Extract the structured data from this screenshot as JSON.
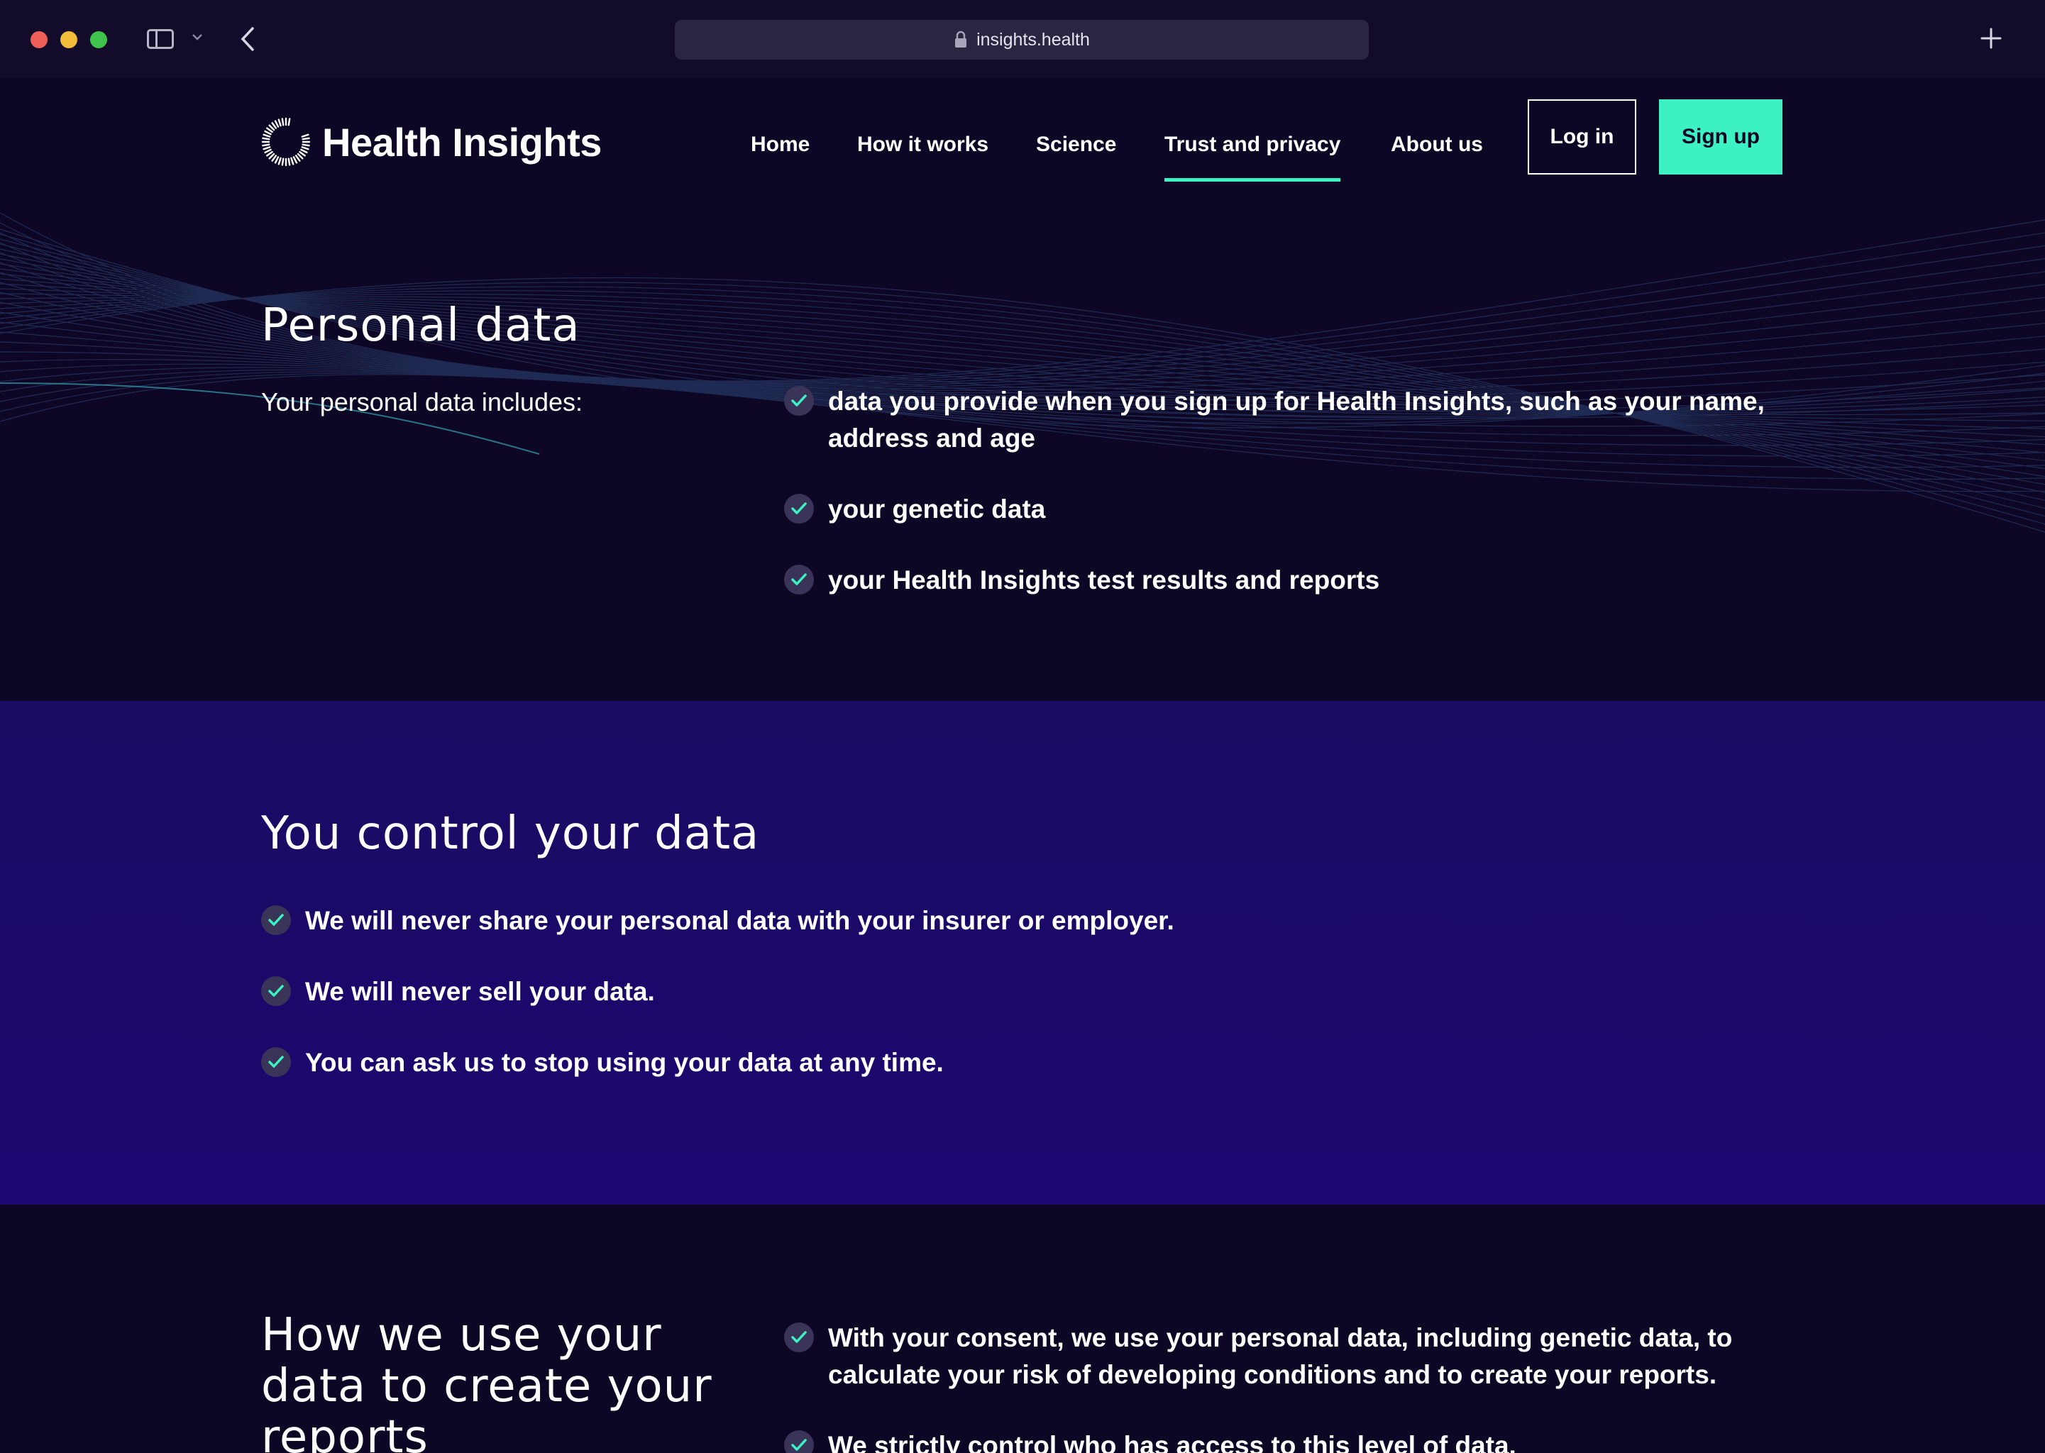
{
  "browser": {
    "url": "insights.health",
    "icons": [
      "sidebar-icon",
      "chevron-down-icon",
      "back-arrow-icon",
      "lock-icon",
      "plus-icon"
    ]
  },
  "header": {
    "brand": "Health Insights",
    "nav": [
      {
        "label": "Home",
        "active": false
      },
      {
        "label": "How it works",
        "active": false
      },
      {
        "label": "Science",
        "active": false
      },
      {
        "label": "Trust and privacy",
        "active": true
      },
      {
        "label": "About us",
        "active": false
      }
    ],
    "login_label": "Log in",
    "signup_label": "Sign up"
  },
  "personal_data": {
    "title": "Personal data",
    "lead": "Your personal data includes:",
    "items": [
      "data you provide when you sign up for Health Insights, such as your name, address and age",
      "your genetic data",
      "your Health Insights test results and reports"
    ]
  },
  "control": {
    "title": "You control your data",
    "items": [
      "We will never share your personal data with your insurer or employer.",
      "We will never sell your data.",
      "You can ask us to stop using your data at any time."
    ]
  },
  "usage": {
    "title": "How we use your data to create your reports",
    "items": [
      "With your consent, we use your personal data, including genetic data, to calculate your risk of developing conditions and to create your reports.",
      "We strictly control who has access to this level of data."
    ]
  },
  "colors": {
    "background": "#0e0625",
    "section_alt": "#1a0b62",
    "accent": "#3cf2c2",
    "check_circle": "#3a3458"
  }
}
